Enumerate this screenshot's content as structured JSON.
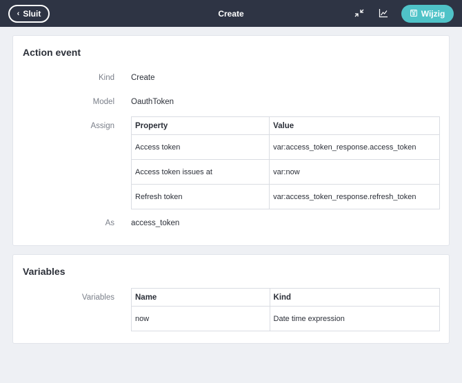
{
  "topbar": {
    "close_label": "Sluit",
    "title": "Create",
    "edit_label": "Wijzig"
  },
  "action_event": {
    "title": "Action event",
    "kind_label": "Kind",
    "kind_value": "Create",
    "model_label": "Model",
    "model_value": "OauthToken",
    "assign_label": "Assign",
    "assign_headers": [
      "Property",
      "Value"
    ],
    "assign_rows": [
      {
        "property": "Access token",
        "value": "var:access_token_response.access_token"
      },
      {
        "property": "Access token issues at",
        "value": "var:now"
      },
      {
        "property": "Refresh token",
        "value": "var:access_token_response.refresh_token"
      }
    ],
    "as_label": "As",
    "as_value": "access_token"
  },
  "variables": {
    "title": "Variables",
    "label": "Variables",
    "headers": [
      "Name",
      "Kind"
    ],
    "rows": [
      {
        "name": "now",
        "kind": "Date time expression"
      }
    ]
  },
  "colors": {
    "topbar_bg": "#2e3444",
    "accent": "#4fc3c8",
    "page_bg": "#eef0f4"
  },
  "icons": {
    "close": "chevron-left-icon",
    "collapse": "collapse-arrows-icon",
    "chart": "line-chart-icon",
    "edit": "save-disk-icon"
  }
}
